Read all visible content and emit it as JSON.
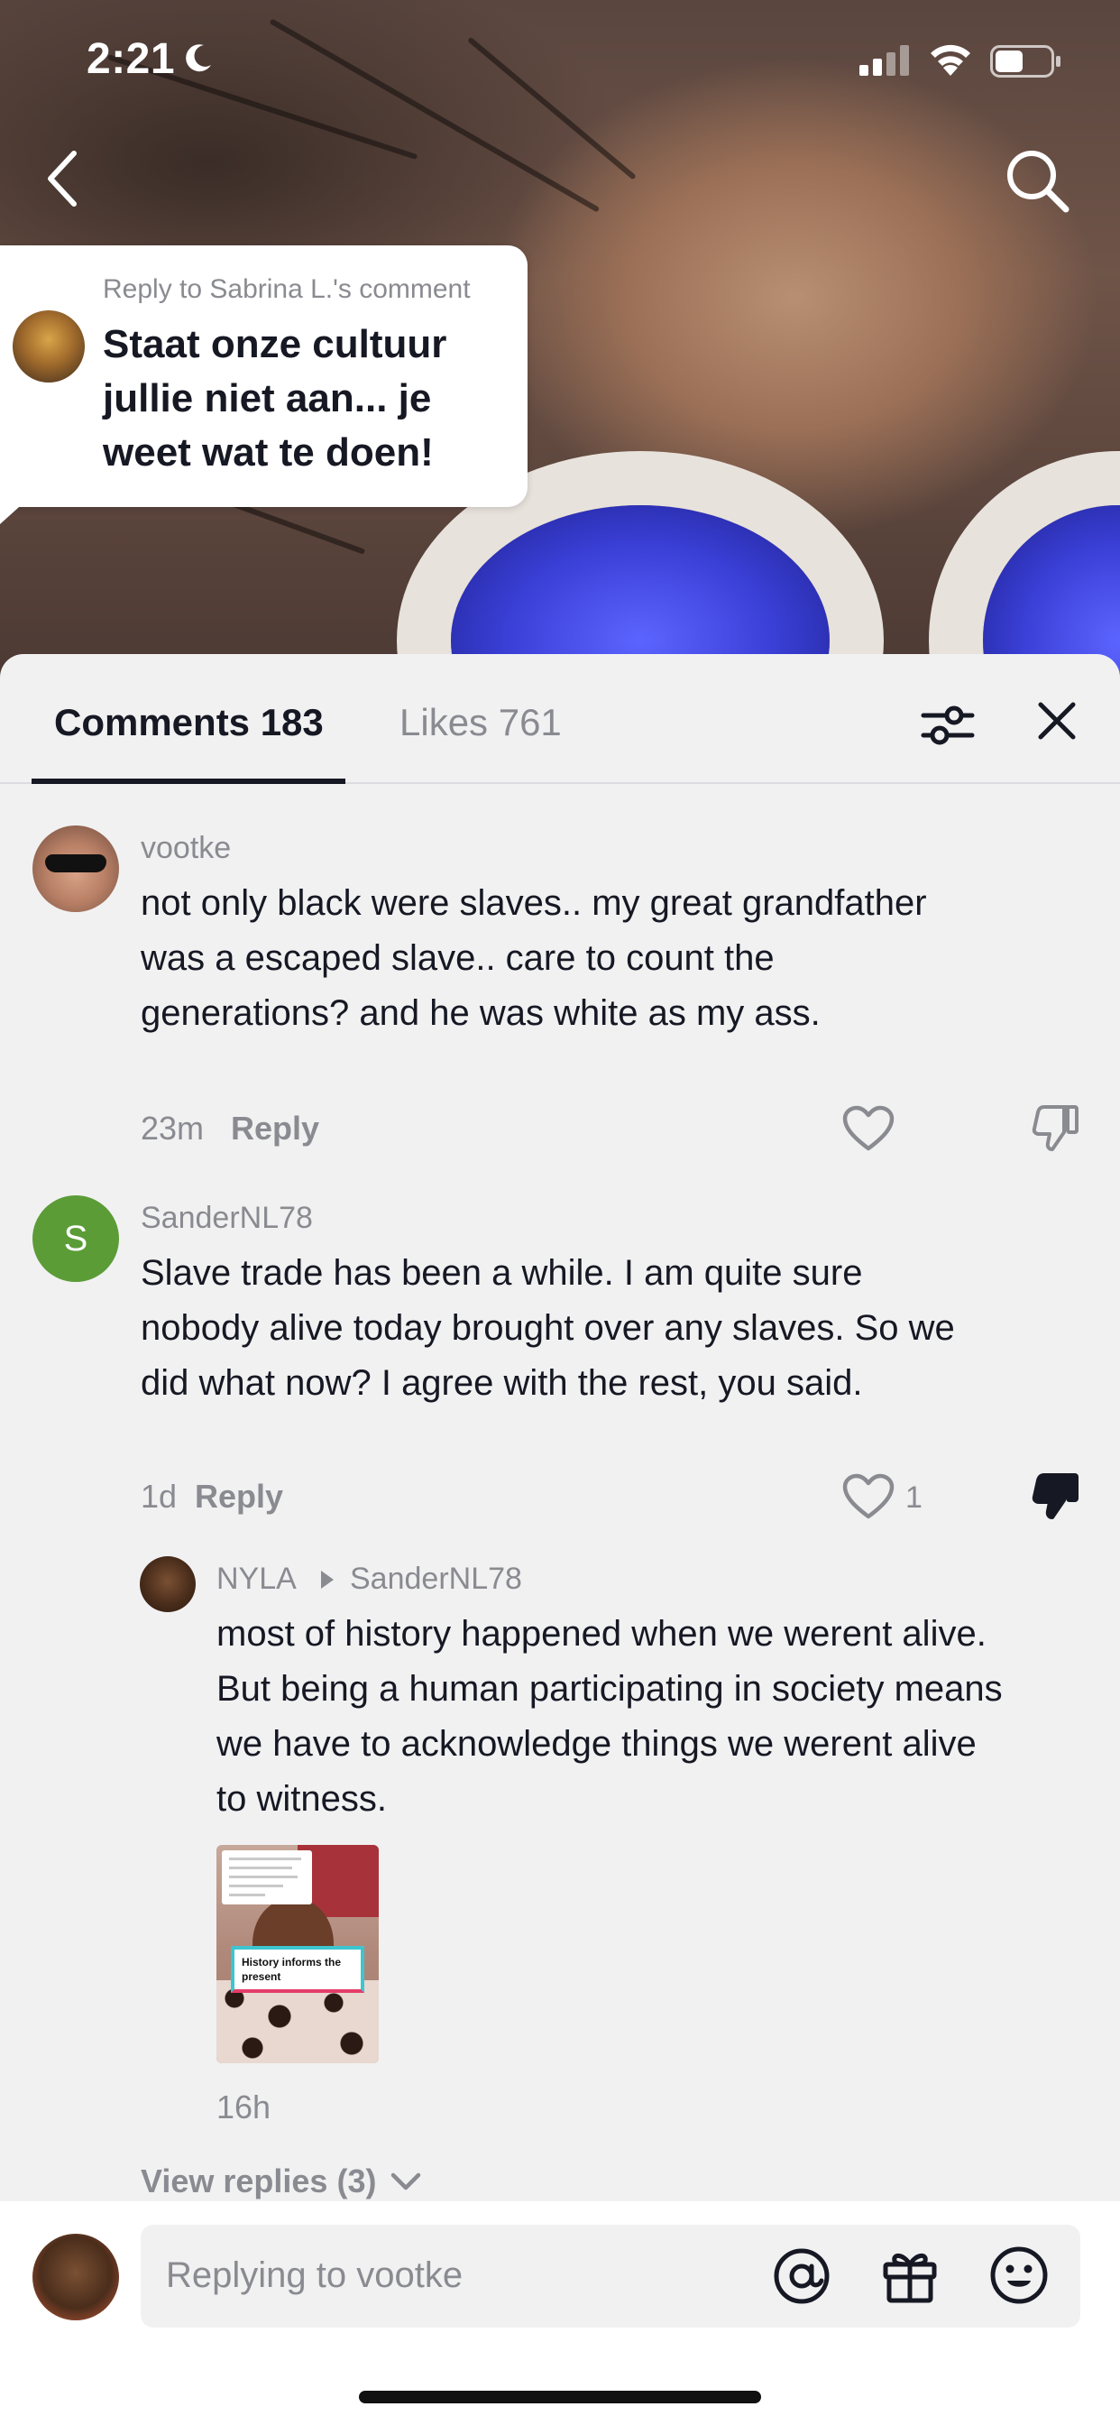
{
  "status_bar": {
    "time": "2:21"
  },
  "reply_bubble": {
    "header": "Reply to Sabrina L.'s comment",
    "text": "Staat onze cultuur jullie niet aan... je weet wat te doen!"
  },
  "tabs": {
    "comments": "Comments 183",
    "likes": "Likes 761"
  },
  "comments": [
    {
      "username": "vootke",
      "text": "not only black were slaves.. my great grandfather was a escaped slave.. care to count the generations? and he was white as my ass.",
      "time": "23m",
      "reply_label": "Reply",
      "like_count": ""
    },
    {
      "username": "SanderNL78",
      "avatar_letter": "S",
      "text": "Slave trade has been a while. I am quite sure nobody alive today brought over any slaves. So we did what now? I agree with the rest, you said.",
      "time": "1d",
      "reply_label": "Reply",
      "like_count": "1"
    }
  ],
  "reply": {
    "username": "NYLA",
    "reply_to": "SanderNL78",
    "text": "most of history happened when we werent alive. But being a human participating in society means we have to acknowledge things we werent alive to witness.",
    "video_caption": "History informs the present",
    "time": "16h"
  },
  "view_replies": "View replies (3)",
  "input": {
    "placeholder": "Replying to vootke"
  },
  "colors": {
    "accent_dark": "#161823",
    "muted": "#8a8b91",
    "sander_avatar": "#5b9c37"
  },
  "icons": [
    "moon-icon",
    "signal-icon",
    "wifi-icon",
    "battery-icon",
    "back-arrow-icon",
    "search-icon",
    "filter-icon",
    "close-icon",
    "heart-icon",
    "thumbs-down-icon",
    "chevron-down-icon",
    "at-icon",
    "gift-icon",
    "emoji-icon"
  ]
}
